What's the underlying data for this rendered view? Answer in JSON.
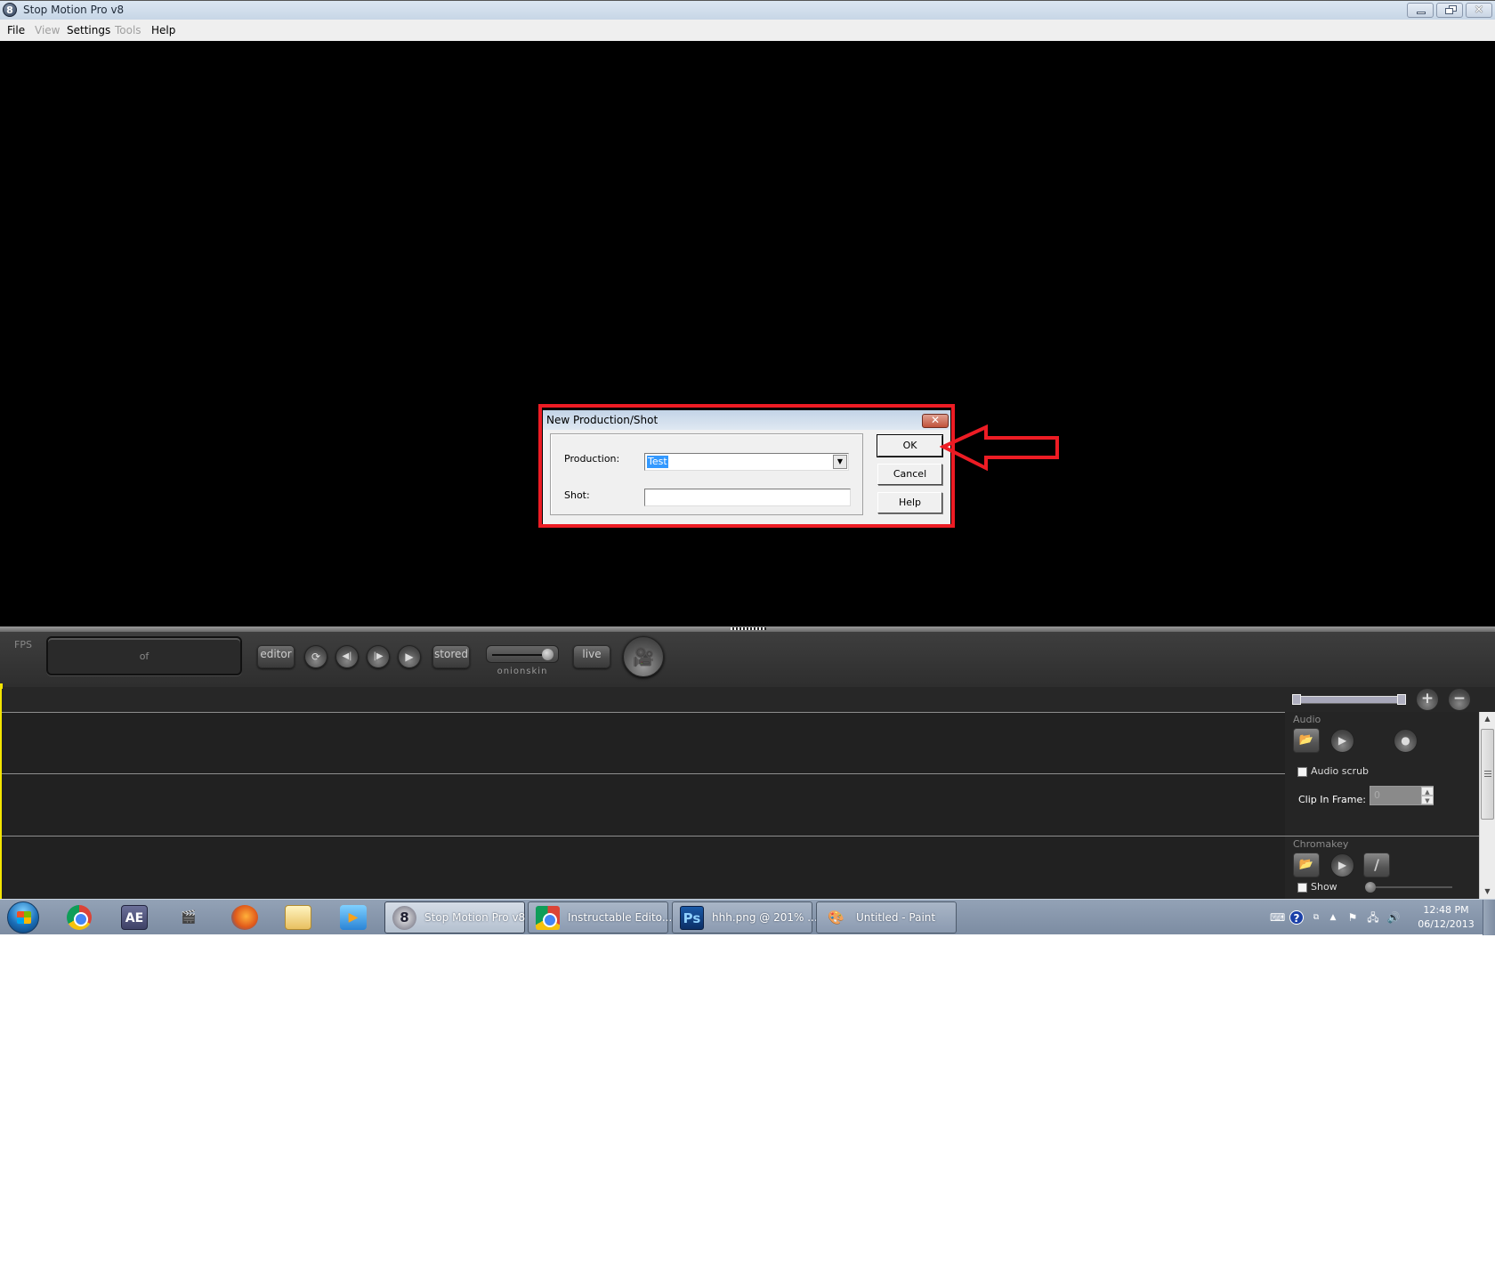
{
  "window": {
    "title": "Stop Motion Pro v8",
    "app_icon_glyph": "8",
    "controls": {
      "minimize": "minimize-icon",
      "restore": "restore-icon",
      "close": "close-icon",
      "close_glyph": "✕"
    }
  },
  "menu": {
    "items": [
      {
        "label": "File",
        "enabled": true
      },
      {
        "label": "View",
        "enabled": false
      },
      {
        "label": "Settings",
        "enabled": true
      },
      {
        "label": "Tools",
        "enabled": false
      },
      {
        "label": "Help",
        "enabled": true
      }
    ]
  },
  "controls": {
    "fps_label": "FPS",
    "frame_counter": "of",
    "editor_label": "editor",
    "stored_label": "stored",
    "live_label": "live",
    "onionskin_label": "onionskin",
    "onionskin_value": 0.9,
    "loop_glyph": "⟳",
    "step_back_glyph": "◀|",
    "step_forward_glyph": "|▶",
    "play_glyph": "▶",
    "camera_glyph": "🎥"
  },
  "timeline": {
    "zoom_in_glyph": "+",
    "zoom_out_glyph": "−",
    "audio": {
      "section_label": "Audio",
      "open_glyph": "📂",
      "play_glyph": "▶",
      "record_glyph": "●",
      "audio_scrub_label": "Audio scrub",
      "audio_scrub_checked": false,
      "clip_in_frame_label": "Clip In Frame:",
      "clip_in_frame_value": "0"
    },
    "chromakey": {
      "section_label": "Chromakey",
      "open_glyph": "📂",
      "play_glyph": "▶",
      "picker_glyph": "/",
      "show_label": "Show",
      "show_checked": false,
      "threshold": 0
    }
  },
  "dialog": {
    "title": "New Production/Shot",
    "close_glyph": "✕",
    "production_label": "Production:",
    "production_value": "Test",
    "shot_label": "Shot:",
    "shot_value": "",
    "ok_label": "OK",
    "cancel_label": "Cancel",
    "help_label": "Help"
  },
  "annotation": {
    "color": "#ed1c24",
    "target": "OK button"
  },
  "taskbar": {
    "pinned": [
      {
        "name": "chrome",
        "glyph": ""
      },
      {
        "name": "after-effects",
        "glyph": "AE"
      },
      {
        "name": "clapper",
        "glyph": "🎬"
      },
      {
        "name": "firefox",
        "glyph": ""
      },
      {
        "name": "explorer",
        "glyph": ""
      },
      {
        "name": "media-player",
        "glyph": "▶"
      }
    ],
    "tasks": [
      {
        "label": "Stop Motion Pro v8",
        "icon_glyph": "8",
        "active": true
      },
      {
        "label": "Instructable Edito...",
        "icon_glyph": "",
        "active": false
      },
      {
        "label": "hhh.png @ 201% ...",
        "icon_glyph": "Ps",
        "active": false
      },
      {
        "label": "Untitled - Paint",
        "icon_glyph": "🎨",
        "active": false
      }
    ],
    "tray": {
      "time": "12:48 PM",
      "date": "06/12/2013",
      "icons": [
        "keyboard-icon",
        "help-icon",
        "network-small-icon",
        "show-hidden-icon",
        "action-center-flag-icon",
        "network-icon",
        "volume-icon"
      ]
    }
  }
}
